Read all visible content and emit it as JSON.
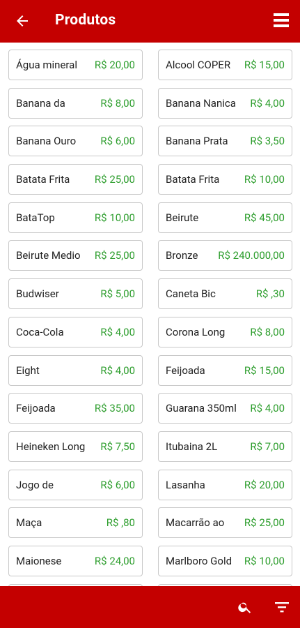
{
  "header": {
    "title": "Produtos"
  },
  "products": {
    "left": [
      {
        "name": "Água mineral",
        "price": "R$ 20,00"
      },
      {
        "name": "Banana da",
        "price": "R$ 8,00"
      },
      {
        "name": "Banana Ouro",
        "price": "R$ 6,00"
      },
      {
        "name": "Batata Frita",
        "price": "R$ 25,00"
      },
      {
        "name": "BataTop",
        "price": "R$ 10,00"
      },
      {
        "name": "Beirute Medio",
        "price": "R$ 25,00"
      },
      {
        "name": "Budwiser",
        "price": "R$ 5,00"
      },
      {
        "name": "Coca-Cola",
        "price": "R$ 4,00"
      },
      {
        "name": "Eight",
        "price": "R$ 4,00"
      },
      {
        "name": "Feijoada",
        "price": "R$ 35,00"
      },
      {
        "name": "Heineken Long",
        "price": "R$ 7,50"
      },
      {
        "name": "Jogo de",
        "price": "R$ 6,00"
      },
      {
        "name": "Maça",
        "price": "R$ ,80"
      },
      {
        "name": "Maionese",
        "price": "R$ 24,00"
      },
      {
        "name": "",
        "price": ""
      }
    ],
    "right": [
      {
        "name": "Alcool COPER",
        "price": "R$ 15,00"
      },
      {
        "name": "Banana Nanica",
        "price": "R$ 4,00"
      },
      {
        "name": "Banana Prata",
        "price": "R$ 3,50"
      },
      {
        "name": "Batata Frita",
        "price": "R$ 10,00"
      },
      {
        "name": "Beirute",
        "price": "R$ 45,00"
      },
      {
        "name": "Bronze",
        "price": "R$ 240.000,00"
      },
      {
        "name": "Caneta Bic",
        "price": "R$ ,30"
      },
      {
        "name": "Corona Long",
        "price": "R$ 8,00"
      },
      {
        "name": "Feijoada",
        "price": "R$ 15,00"
      },
      {
        "name": "Guarana 350ml",
        "price": "R$ 4,00"
      },
      {
        "name": "Itubaina 2L",
        "price": "R$ 7,00"
      },
      {
        "name": "Lasanha",
        "price": "R$ 20,00"
      },
      {
        "name": "Macarrão ao",
        "price": "R$ 25,00"
      },
      {
        "name": "Marlboro Gold",
        "price": "R$ 10,00"
      },
      {
        "name": "",
        "price": ""
      }
    ]
  },
  "colors": {
    "primary": "#c40000",
    "price": "#2e9e2e",
    "text": "#222222"
  },
  "icons": {
    "back": "arrow-back-icon",
    "menu": "menu-icon",
    "search": "search-icon",
    "filter": "filter-icon"
  }
}
